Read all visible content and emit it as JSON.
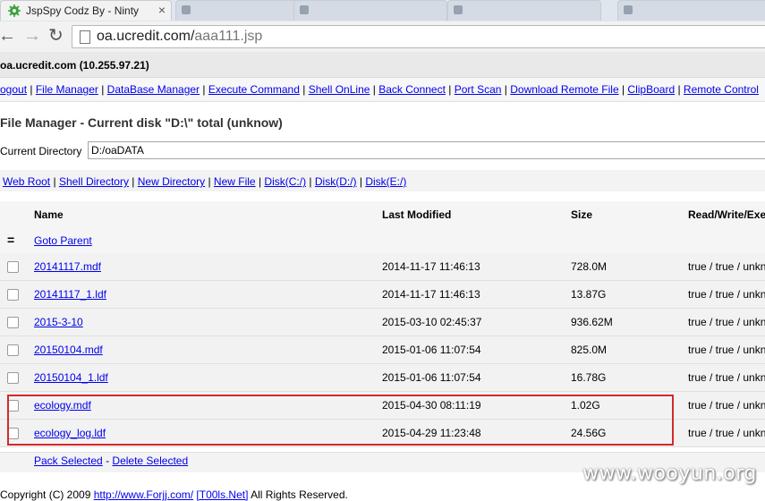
{
  "browser": {
    "active_tab_title": "JspSpy Codz By - Ninty",
    "url_host": "oa.ucredit.com/",
    "url_path": "aaa111.jsp",
    "inactive_tabs": [
      "",
      "",
      "",
      "",
      ""
    ]
  },
  "host": {
    "label": "oa.ucredit.com (10.255.97.21)"
  },
  "menu": {
    "items": [
      "ogout",
      "File Manager",
      "DataBase Manager",
      "Execute Command",
      "Shell OnLine",
      "Back Connect",
      "Port Scan",
      "Download Remote File",
      "ClipBoard",
      "Remote Control"
    ]
  },
  "file_manager": {
    "title": "File Manager - Current disk \"D:\\\" total (unknow)",
    "current_directory_label": "Current Directory",
    "current_directory_value": "D:/oaDATA",
    "disk_links": [
      "Web Root",
      "Shell Directory",
      "New Directory",
      "New File",
      "Disk(C:/)",
      "Disk(D:/)",
      "Disk(E:/)"
    ],
    "columns": {
      "name": "Name",
      "modified": "Last Modified",
      "size": "Size",
      "rwx": "Read/Write/Exe"
    },
    "parent_glyph": "=",
    "goto_parent": "Goto Parent",
    "files": [
      {
        "name": "20141117.mdf",
        "modified": "2014-11-17 11:46:13",
        "size": "728.0M",
        "rwx": "true / true / unknow"
      },
      {
        "name": "20141117_1.ldf",
        "modified": "2014-11-17 11:46:13",
        "size": "13.87G",
        "rwx": "true / true / unknow"
      },
      {
        "name": "2015-3-10",
        "modified": "2015-03-10 02:45:37",
        "size": "936.62M",
        "rwx": "true / true / unknow"
      },
      {
        "name": "20150104.mdf",
        "modified": "2015-01-06 11:07:54",
        "size": "825.0M",
        "rwx": "true / true / unknow"
      },
      {
        "name": "20150104_1.ldf",
        "modified": "2015-01-06 11:07:54",
        "size": "16.78G",
        "rwx": "true / true / unknow"
      },
      {
        "name": "ecology.mdf",
        "modified": "2015-04-30 08:11:19",
        "size": "1.02G",
        "rwx": "true / true / unknow"
      },
      {
        "name": "ecology_log.ldf",
        "modified": "2015-04-29 11:23:48",
        "size": "24.56G",
        "rwx": "true / true / unknow"
      }
    ],
    "pack_selected": "Pack Selected",
    "action_sep": "-",
    "delete_selected": "Delete Selected"
  },
  "footer": {
    "prefix": "Copyright (C) 2009 ",
    "link1": "http://www.Forjj.com/",
    "link2": "[T00ls.Net]",
    "suffix": " All Rights Reserved."
  },
  "watermark": "www.wooyun.org",
  "colors": {
    "highlight": "#d32a2a",
    "link": "#0000ee"
  }
}
